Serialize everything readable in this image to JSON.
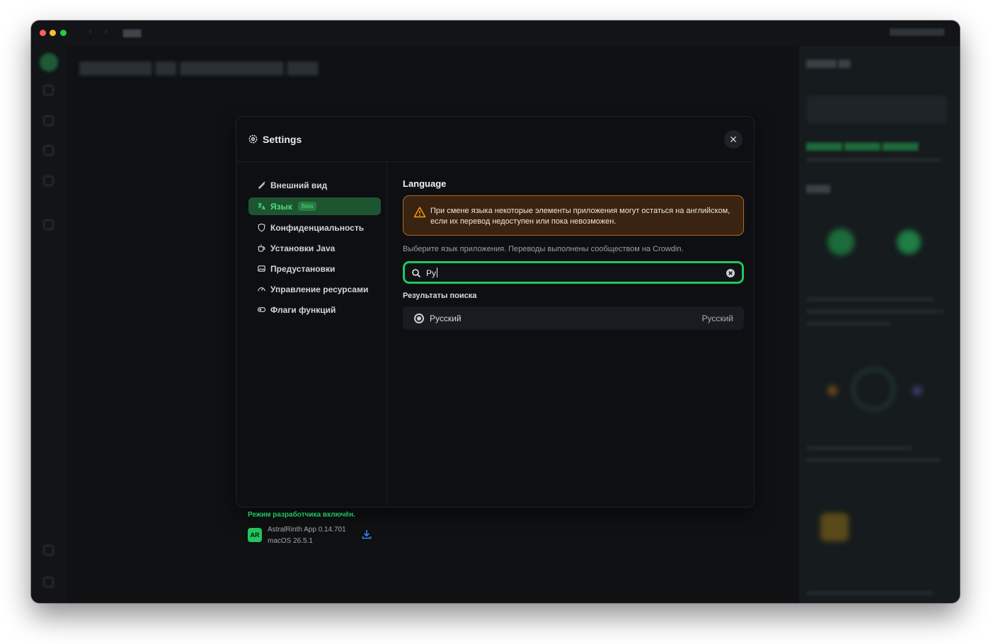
{
  "colors": {
    "accent": "#22c55e",
    "active_bg": "#1d5530",
    "warning_border": "#b06a1f",
    "warning_bg": "#3a2310",
    "modal_bg": "#0d0f12"
  },
  "modal": {
    "title": "Settings",
    "close_label": "✕",
    "sidebar": {
      "items": [
        {
          "label": "Внешний вид",
          "icon": "brush-icon",
          "active": false
        },
        {
          "label": "Язык",
          "icon": "language-icon",
          "active": true,
          "badge": "Beta"
        },
        {
          "label": "Конфиденциальность",
          "icon": "shield-icon",
          "active": false
        },
        {
          "label": "Установки Java",
          "icon": "coffee-icon",
          "active": false
        },
        {
          "label": "Предустановки",
          "icon": "gallery-icon",
          "active": false
        },
        {
          "label": "Управление ресурсами",
          "icon": "gauge-icon",
          "active": false
        },
        {
          "label": "Флаги функций",
          "icon": "toggle-icon",
          "active": false
        }
      ],
      "dev_mode": "Режим разработчика включён.",
      "app_logo_text": "AR",
      "app_version": "AstralRinth App 0.14.701",
      "os_version": "macOS 26.5.1"
    },
    "language": {
      "section_title": "Language",
      "warning": "При смене языка некоторые элементы приложения могут остаться на английском, если их перевод недоступен или пока невозможен.",
      "hint": "Выберите язык приложения. Переводы выполнены сообществом на Crowdin.",
      "search_value": "Ру",
      "results_label": "Результаты поиска",
      "results": [
        {
          "name": "Русский",
          "native": "Русский",
          "selected": true
        }
      ]
    }
  }
}
